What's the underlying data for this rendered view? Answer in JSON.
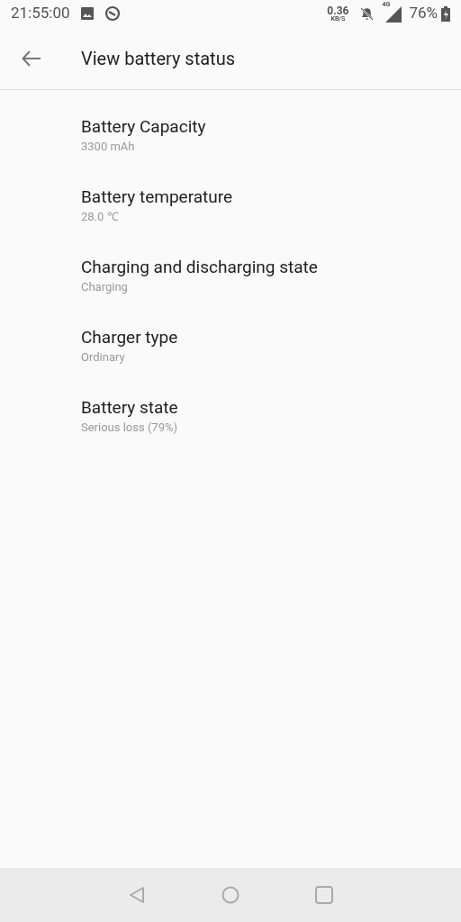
{
  "status_bar": {
    "time": "21:55:00",
    "speed": "0.36",
    "speed_unit": "KB/S",
    "network": "4G",
    "battery": "76%"
  },
  "toolbar": {
    "title": "View battery status"
  },
  "items": [
    {
      "title": "Battery Capacity",
      "value": "3300 mAh"
    },
    {
      "title": "Battery temperature",
      "value": "28.0 ℃"
    },
    {
      "title": "Charging and discharging state",
      "value": "Charging"
    },
    {
      "title": "Charger type",
      "value": "Ordinary"
    },
    {
      "title": "Battery state",
      "value": "Serious loss (79%)"
    }
  ]
}
